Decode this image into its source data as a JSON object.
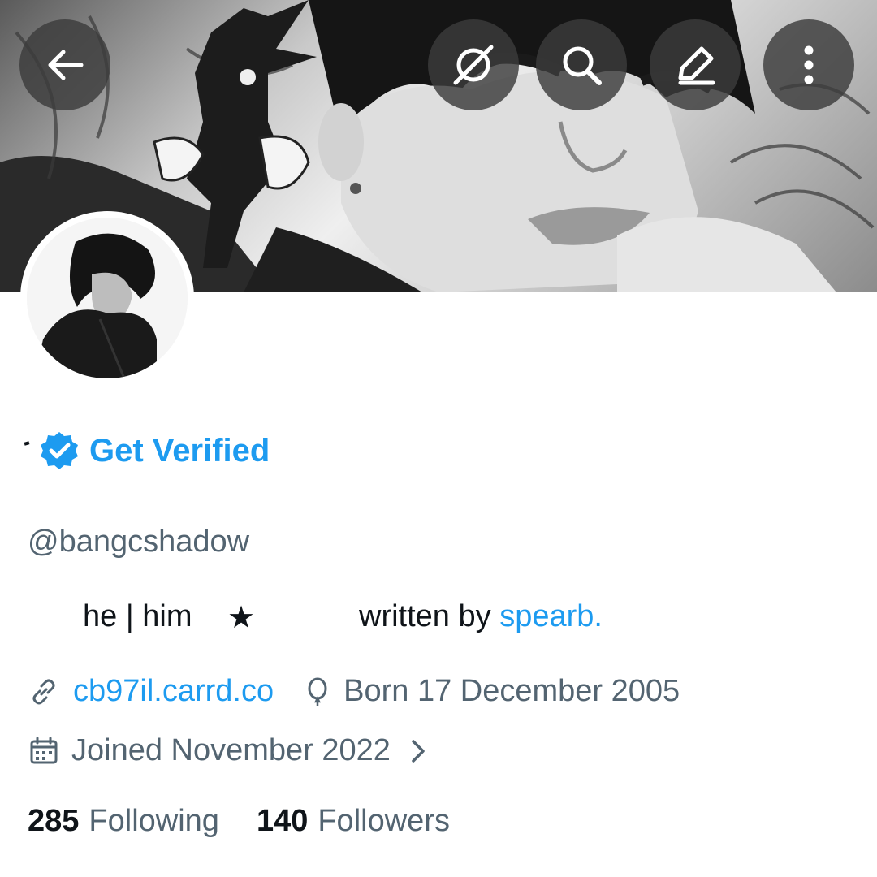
{
  "header": {
    "back_icon": "arrow-left-icon",
    "actions": [
      "grok-icon",
      "search-icon",
      "edit-icon",
      "more-vertical-icon"
    ]
  },
  "profile": {
    "name": "",
    "verified_badge_icon": "verified-badge-icon",
    "get_verified_label": "Get Verified",
    "handle": "@bangcshadow",
    "bio_pronouns": "he | him",
    "bio_star": "★",
    "bio_written_by": "written by",
    "bio_author_link": "spearb.",
    "website": "cb97il.carrd.co",
    "birth": "Born 17 December 2005",
    "joined": "Joined November 2022",
    "following_count": "285",
    "following_label": "Following",
    "followers_count": "140",
    "followers_label": "Followers"
  },
  "colors": {
    "accent": "#1d9bf0",
    "secondary_text": "#536471",
    "primary_text": "#0f1419"
  }
}
